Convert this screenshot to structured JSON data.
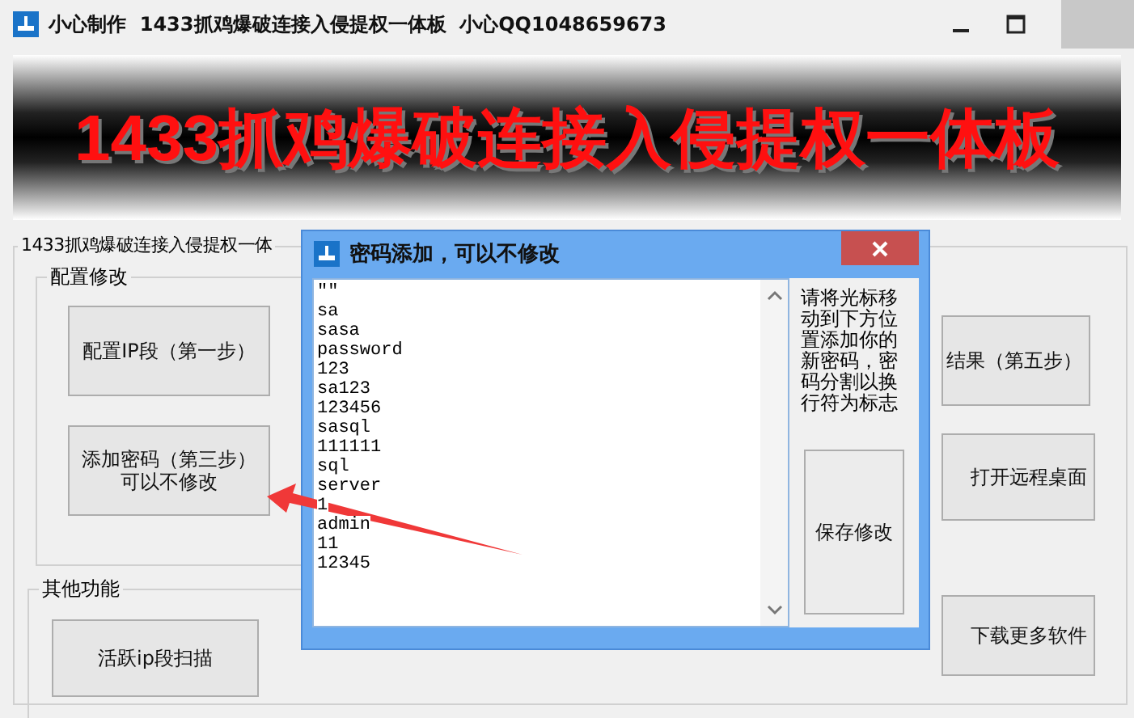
{
  "window": {
    "title": "小心制作  1433抓鸡爆破连接入侵提权一体板  小心QQ1048659673"
  },
  "banner": {
    "text": "1433抓鸡爆破连接入侵提权一体板"
  },
  "main_group": {
    "title": "1433抓鸡爆破连接入侵提权一体",
    "config_group": {
      "title": "配置修改",
      "buttons": [
        {
          "label": "配置IP段（第一步）"
        },
        {
          "label": "添加密码（第三步）",
          "note": "可以不修改"
        }
      ]
    },
    "other_group": {
      "title": "其他功能",
      "buttons": [
        {
          "label": "活跃ip段扫描"
        }
      ]
    },
    "right_buttons": [
      {
        "label": "结果（第五步）"
      },
      {
        "label": "打开远程桌面"
      },
      {
        "label": "下载更多软件"
      }
    ]
  },
  "dialog": {
    "title": "密码添加，可以不修改",
    "passwords": [
      "\"\"",
      "sa",
      "sasa",
      "password",
      "123",
      "sa123",
      "123456",
      "sasql",
      "111111",
      "sql",
      "server",
      "1",
      "admin",
      "11",
      "12345"
    ],
    "hint": "请将光标移动到下方位置添加你的新密码，密码分割以换行符为标志",
    "save_button": "保存修改"
  }
}
